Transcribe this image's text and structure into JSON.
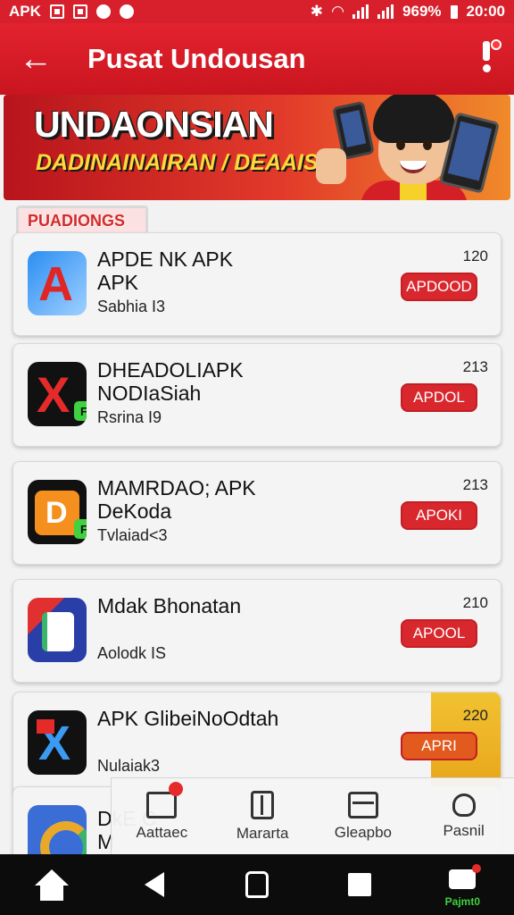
{
  "status_bar": {
    "left_label": "APK",
    "battery": "969%",
    "time": "20:00"
  },
  "app_bar": {
    "title": "Pusat Undousan"
  },
  "banner": {
    "title": "UNDAONSIAN",
    "subtitle": "DADINAINAIRAN / DEAAIS"
  },
  "section": {
    "label": "PUADIONGS"
  },
  "apps": [
    {
      "name": "APDE NK APK\nAPK",
      "sub": "Sabhia I3",
      "count": "120",
      "button": "APDOOD",
      "icon": "app-a-icon"
    },
    {
      "name": "DHEADOLIAPK\nNODIaSiah",
      "sub": "Rsrina I9",
      "count": "213",
      "button": "APDOL",
      "icon": "app-x-icon"
    },
    {
      "name": "MAMRDAO; APK\nDeKoda",
      "sub": "Tvlaiad<3",
      "count": "213",
      "button": "APOKI",
      "icon": "app-d-icon"
    },
    {
      "name": "Mdak Bhonatan",
      "sub": "Aolodk IS",
      "count": "210",
      "button": "APOOL",
      "icon": "app-g-icon"
    },
    {
      "name": "APK GlibeiNoOdtah",
      "sub": "Nulaiak3",
      "count": "220",
      "button": "APRI",
      "icon": "app-x2-icon"
    },
    {
      "name": "DkE C\nM",
      "sub": "",
      "count": "",
      "button": "",
      "icon": "app-c-icon"
    }
  ],
  "tabs": [
    {
      "label": "Aattaec",
      "icon": "folder-icon"
    },
    {
      "label": "Mararta",
      "icon": "clipboard-icon"
    },
    {
      "label": "Gleapbo",
      "icon": "card-icon"
    },
    {
      "label": "Pasnil",
      "icon": "person-icon"
    }
  ],
  "system_nav": {
    "app_label": "Pajmt0"
  },
  "colors": {
    "primary": "#d7202c",
    "button": "#d8282e",
    "banner_yellow": "#ffd93a"
  }
}
